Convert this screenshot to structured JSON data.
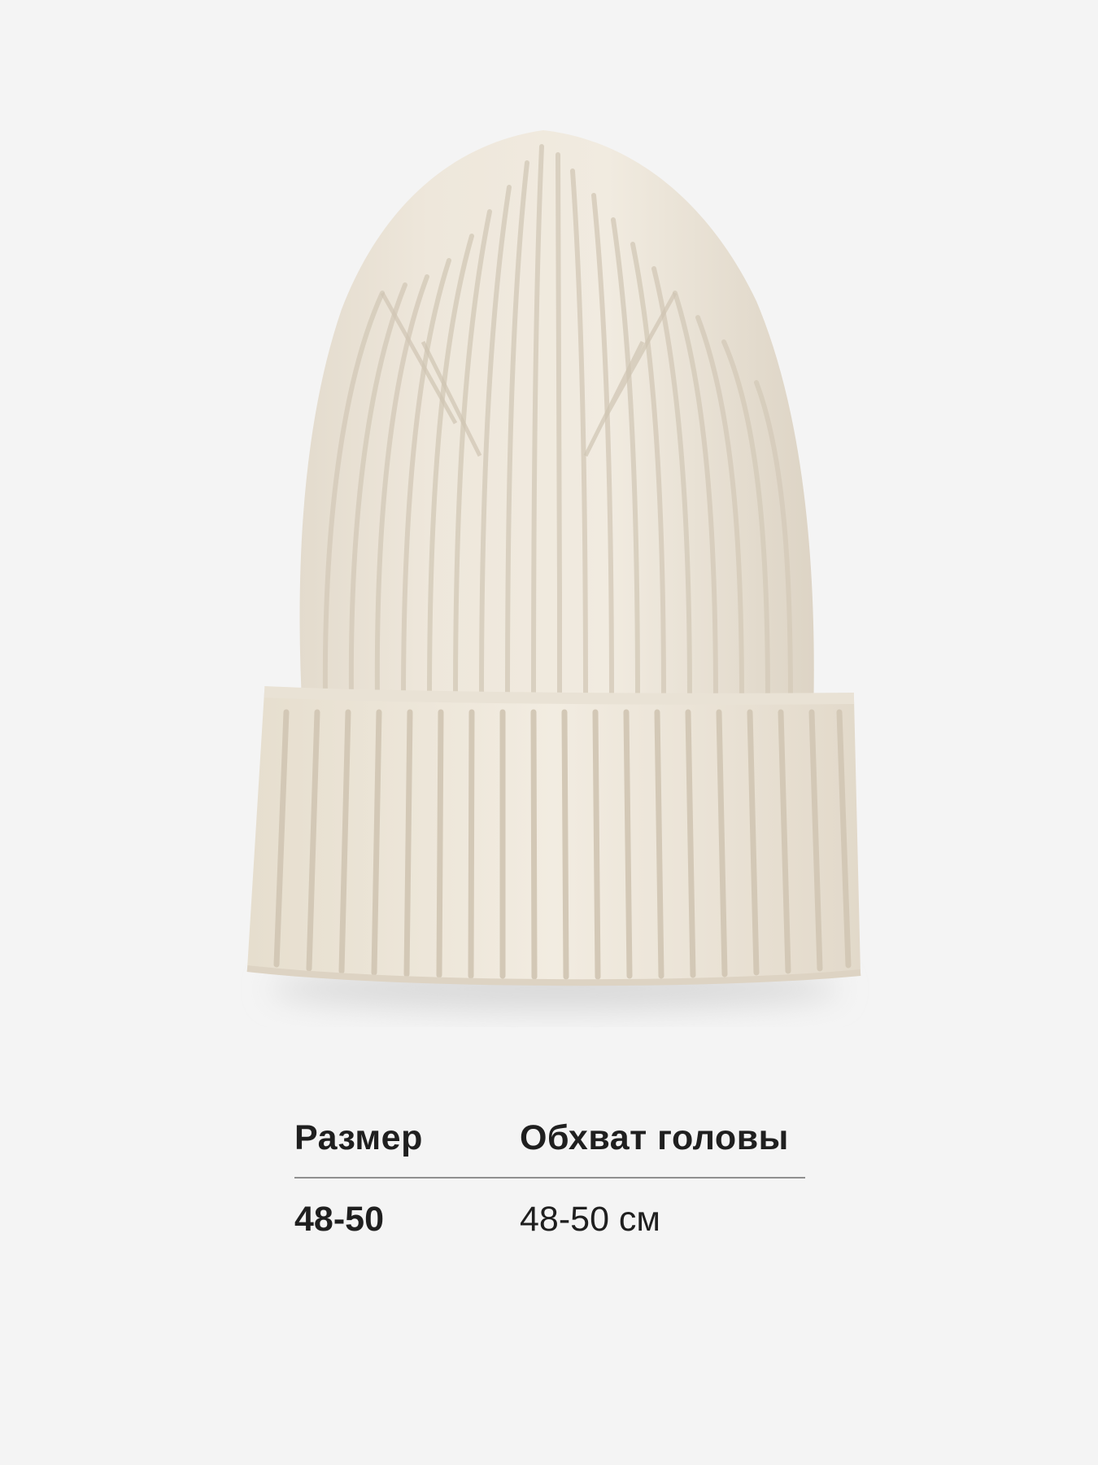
{
  "product": {
    "image_icon": "knit-beanie-icon",
    "color": "#ede6da"
  },
  "size_table": {
    "headers": {
      "size": "Размер",
      "girth": "Обхват головы"
    },
    "rows": [
      {
        "size": "48-50",
        "girth": "48-50 см"
      }
    ]
  },
  "colors": {
    "background": "#f4f4f4",
    "text": "#1f1f1f",
    "divider": "#8f8f8f"
  }
}
